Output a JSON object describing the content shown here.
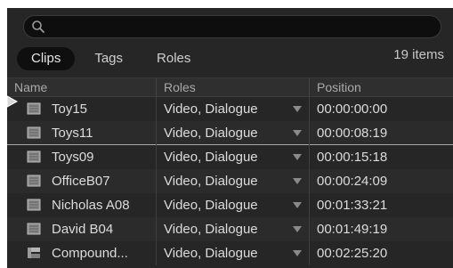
{
  "search": {
    "placeholder": "",
    "value": "",
    "icon": "search-icon"
  },
  "tabs": [
    {
      "label": "Clips",
      "active": true
    },
    {
      "label": "Tags",
      "active": false
    },
    {
      "label": "Roles",
      "active": false
    }
  ],
  "count_label": "19 items",
  "table": {
    "columns": [
      "Name",
      "Roles",
      "Position"
    ],
    "rows": [
      {
        "name": "Toy15",
        "roles": "Video, Dialogue",
        "position": "00:00:00:00",
        "icon": "video-clip-icon"
      },
      {
        "name": "Toys11",
        "roles": "Video, Dialogue",
        "position": "00:00:08:19",
        "icon": "video-clip-icon"
      },
      {
        "name": "Toys09",
        "roles": "Video, Dialogue",
        "position": "00:00:15:18",
        "icon": "video-clip-icon"
      },
      {
        "name": "OfficeB07",
        "roles": "Video, Dialogue",
        "position": "00:00:24:09",
        "icon": "video-clip-icon"
      },
      {
        "name": "Nicholas A08",
        "roles": "Video, Dialogue",
        "position": "00:01:33:21",
        "icon": "video-clip-icon"
      },
      {
        "name": "David B04",
        "roles": "Video, Dialogue",
        "position": "00:01:49:19",
        "icon": "video-clip-icon"
      },
      {
        "name": "Compound...",
        "roles": "Video, Dialogue",
        "position": "00:02:25:20",
        "icon": "compound-clip-icon"
      }
    ]
  },
  "colors": {
    "panel_bg": "#262626",
    "text": "#dcdcdc",
    "header_text": "#a9a9a9",
    "playhead": "#a8a8a8"
  }
}
